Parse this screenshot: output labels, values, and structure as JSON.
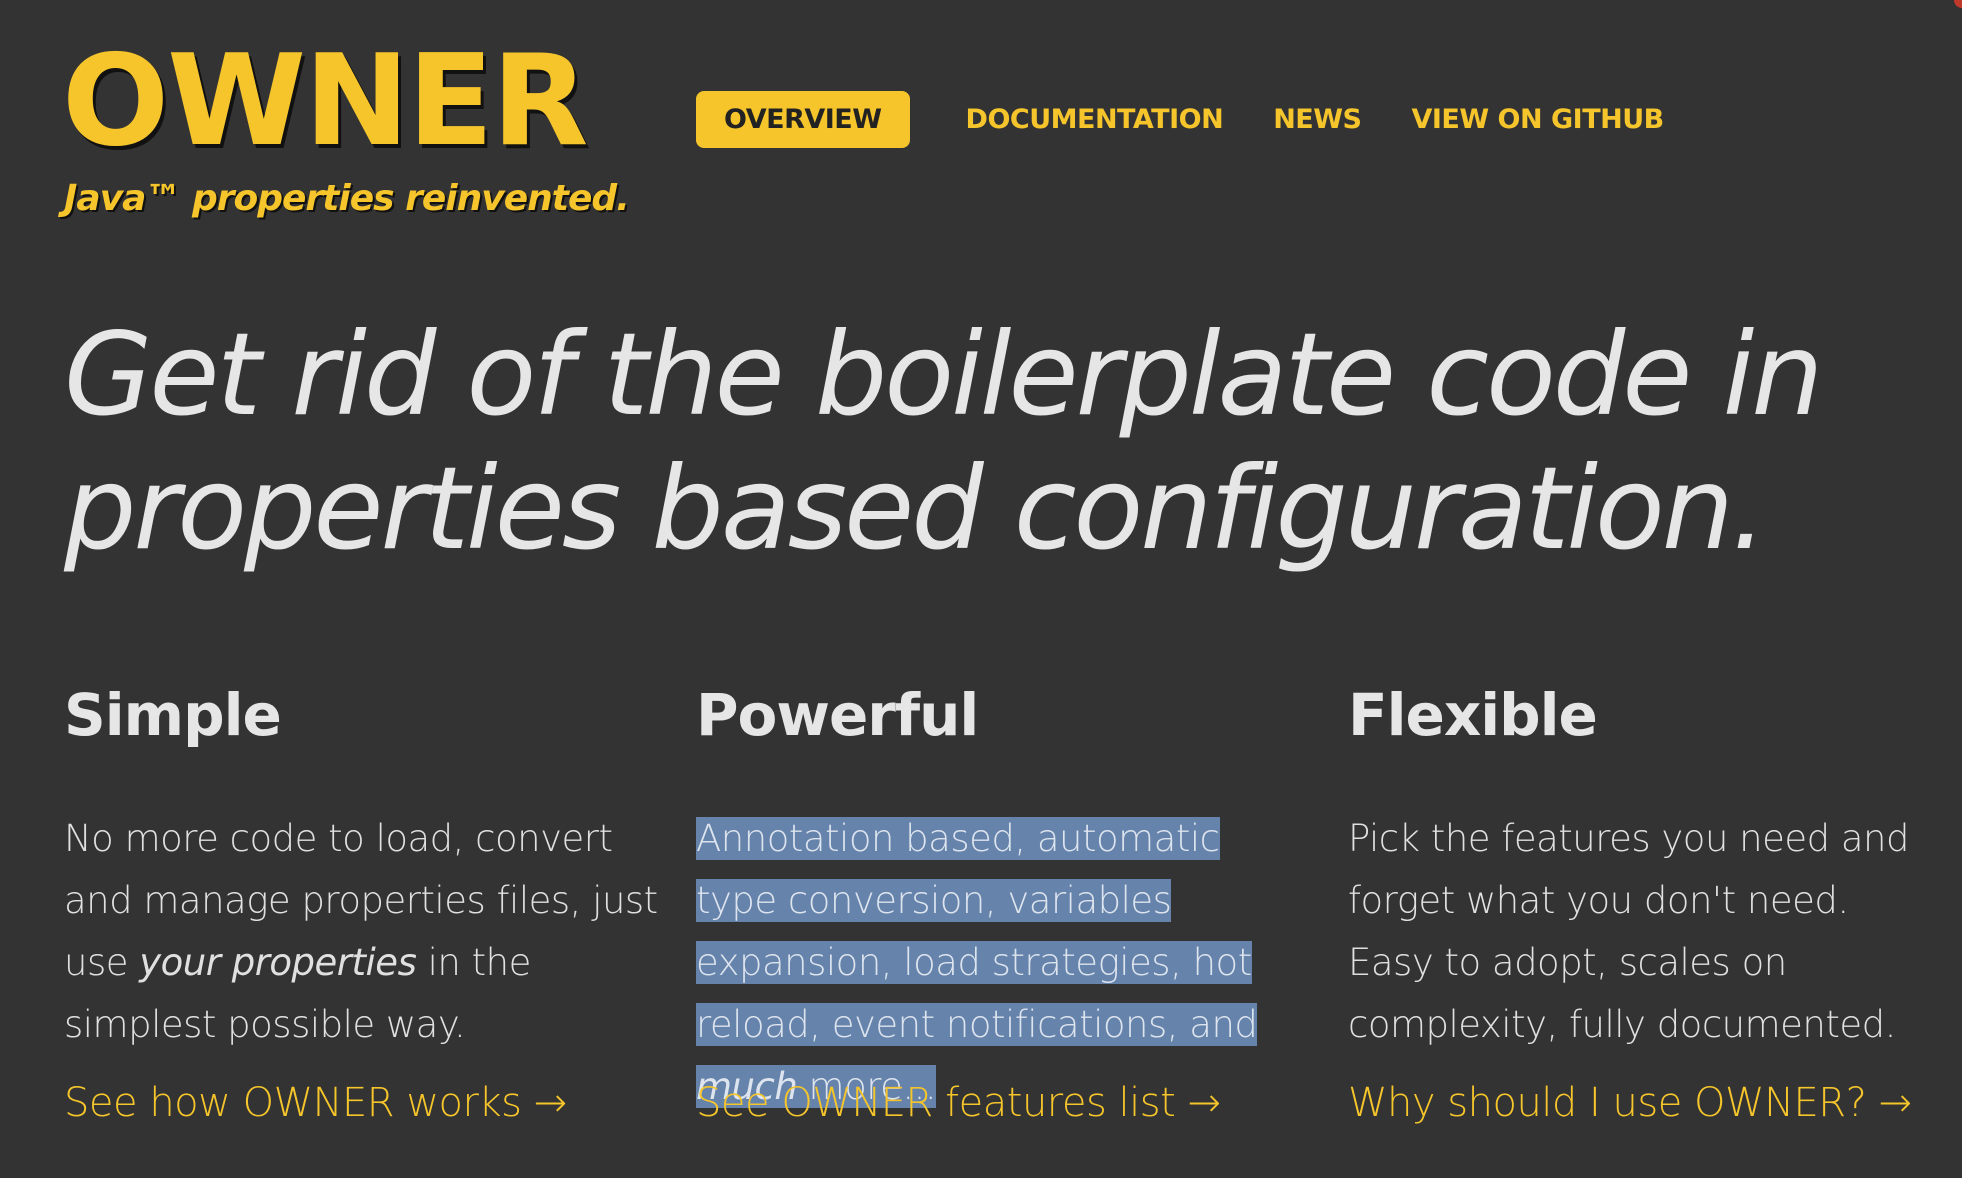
{
  "site": {
    "logo": "OWNER",
    "tagline": "Java™ properties reinvented."
  },
  "nav": {
    "items": [
      {
        "label": "OVERVIEW",
        "active": true
      },
      {
        "label": "DOCUMENTATION",
        "active": false
      },
      {
        "label": "NEWS",
        "active": false
      },
      {
        "label": "VIEW ON GITHUB",
        "active": false
      }
    ]
  },
  "hero": {
    "line1": "Get rid of the boilerplate code in",
    "line2": "properties based configuration."
  },
  "features": [
    {
      "title": "Simple",
      "text_before": "No more code to load, convert and manage properties files, just use ",
      "text_emph": "your properties",
      "text_after": " in the simplest possible way.",
      "link": "See how OWNER works →"
    },
    {
      "title": "Powerful",
      "text_before": "Annotation based, automatic type conversion, variables expansion, load strategies, hot reload, event notifications, and ",
      "text_emph": "much",
      "text_after": " more...",
      "link": "See OWNER features list →"
    },
    {
      "title": "Flexible",
      "text_before": "Pick the features you need and forget what you don't need. Easy to adopt, scales on complexity, fully documented.",
      "link": "Why should I use OWNER? →"
    }
  ],
  "colors": {
    "background": "#333333",
    "accent": "#f5c52b",
    "text": "#e6e6e6",
    "selection": "#6583ab"
  }
}
